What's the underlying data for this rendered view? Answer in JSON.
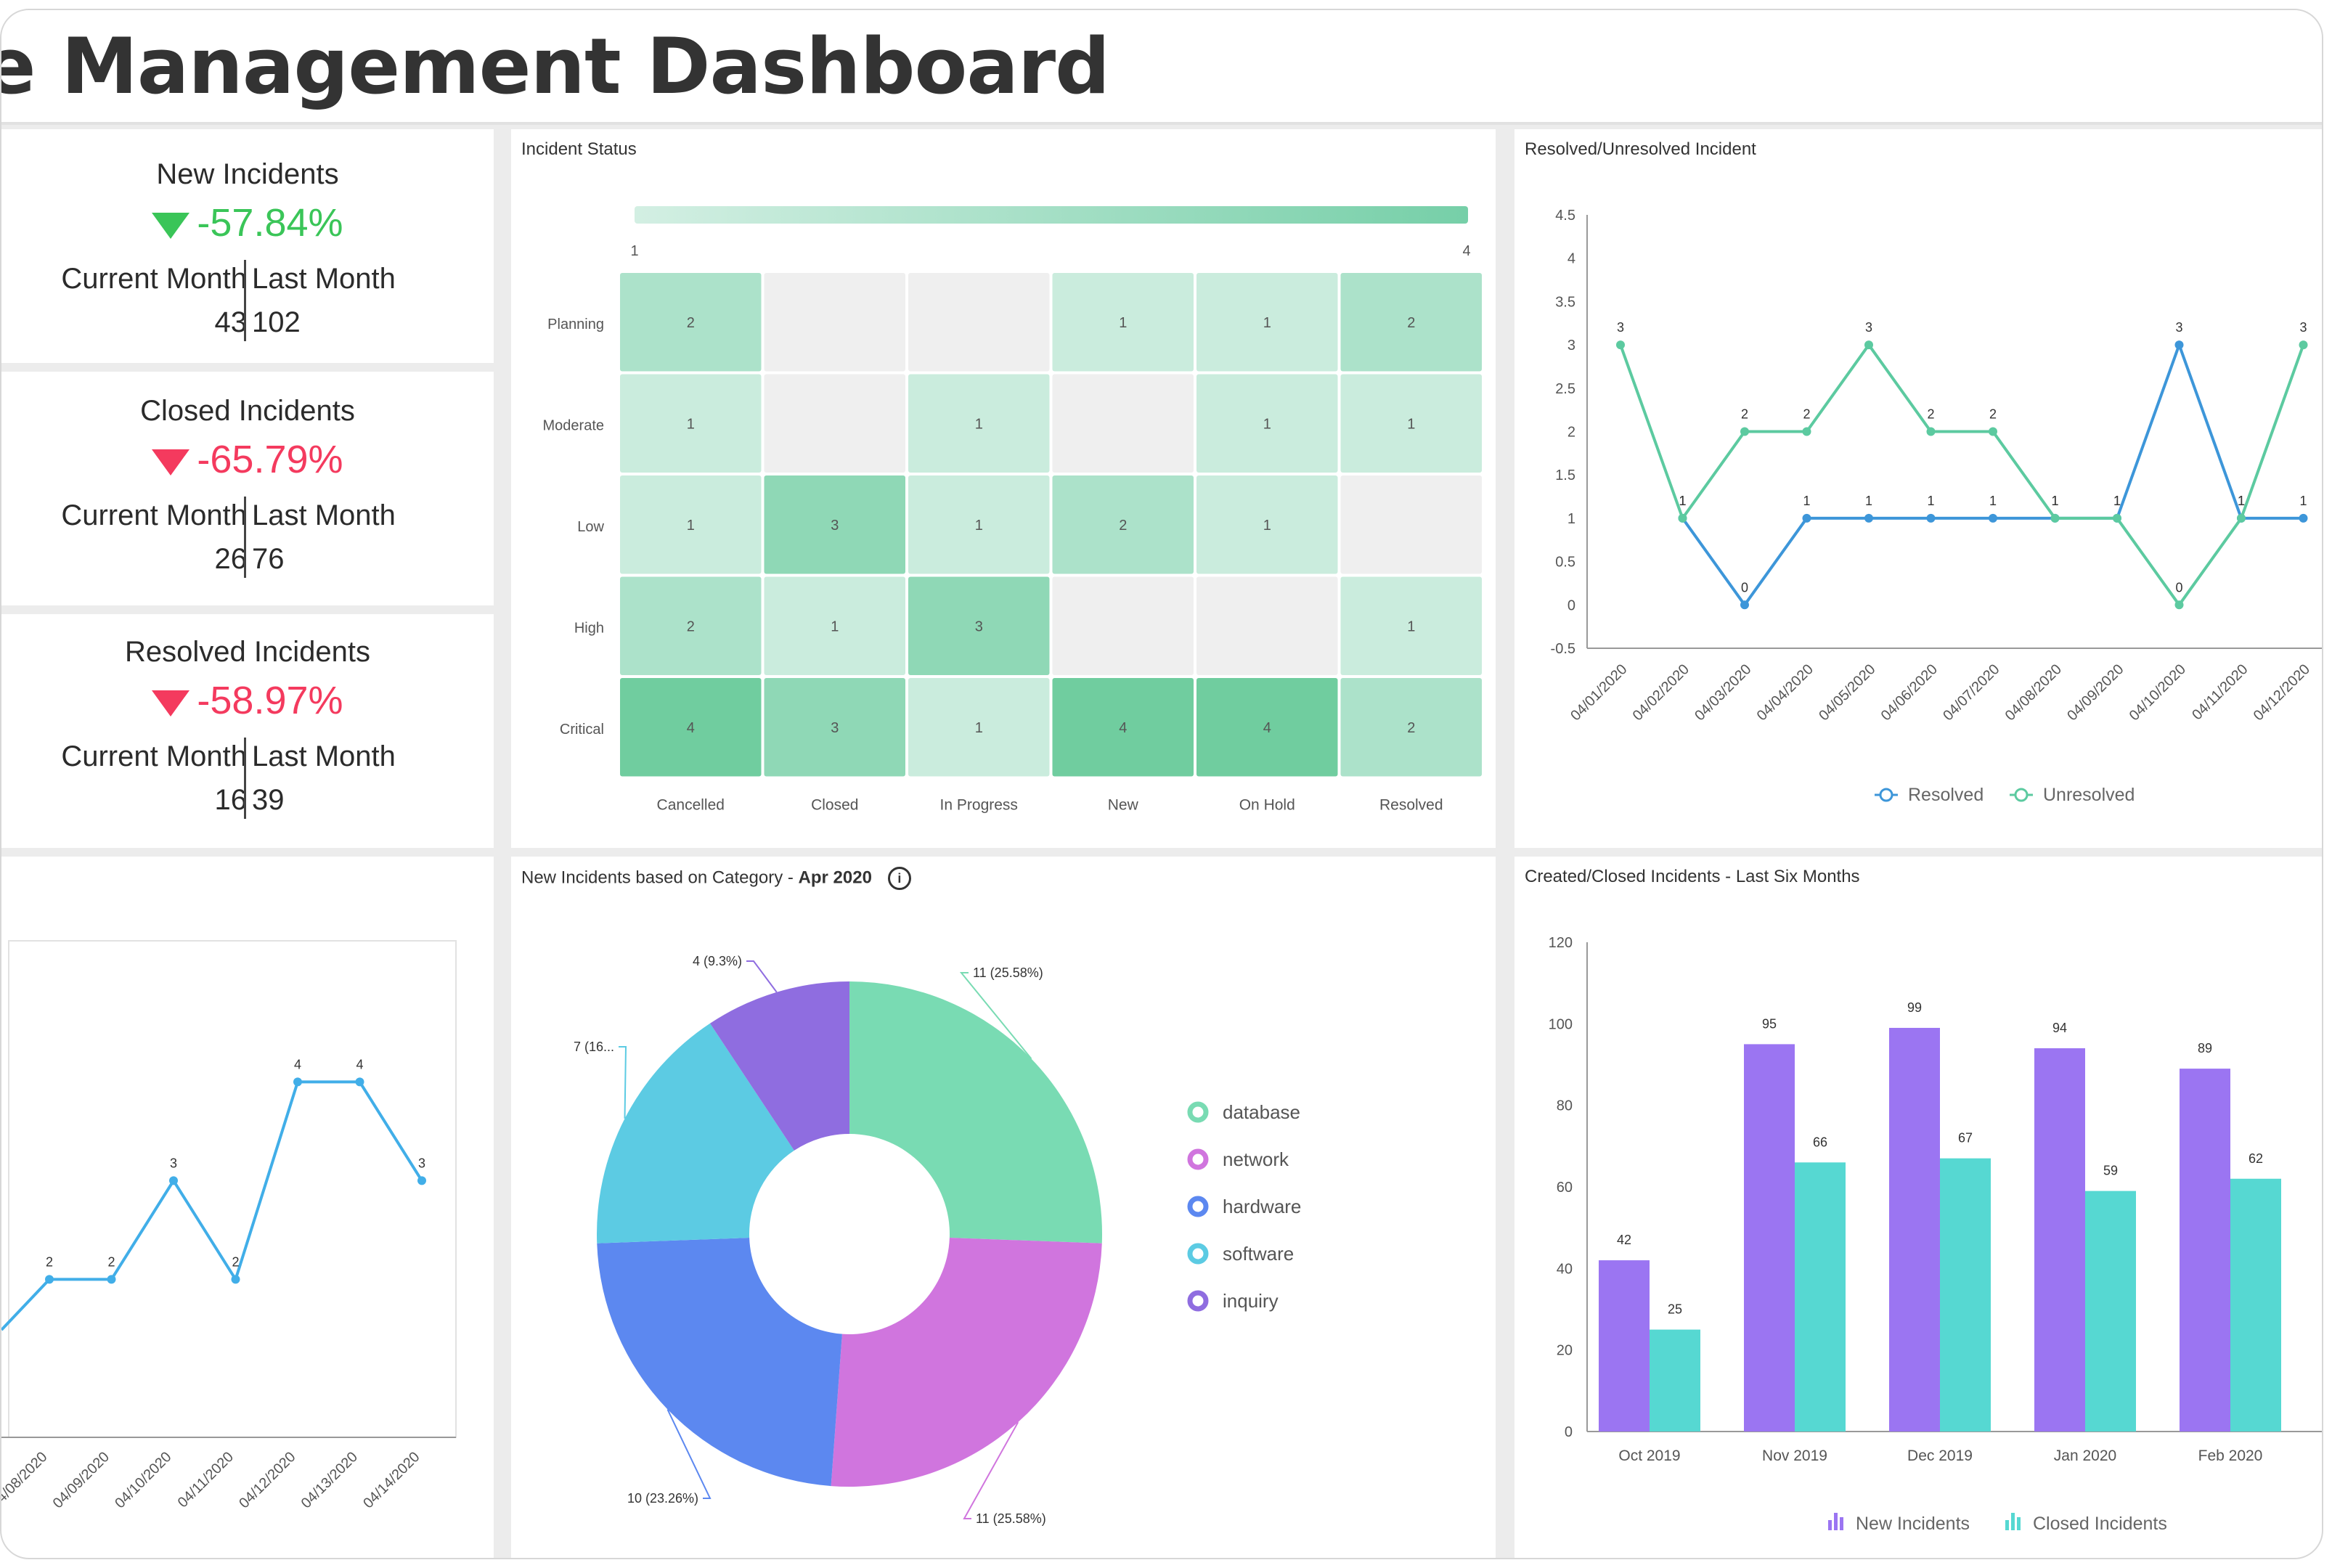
{
  "header": {
    "title": "onse Management Dashboard"
  },
  "kpis": [
    {
      "title": "New Incidents",
      "change": "-57.84%",
      "direction": "down",
      "color": "#3ac558",
      "current_label": "Current Month",
      "last_label": "Last Month",
      "current": "43",
      "last": "102"
    },
    {
      "title": "Closed Incidents",
      "change": "-65.79%",
      "direction": "down",
      "color": "#f43a5e",
      "current_label": "Current Month",
      "last_label": "Last Month",
      "current": "26",
      "last": "76"
    },
    {
      "title": "Resolved Incidents",
      "change": "-58.97%",
      "direction": "down",
      "color": "#f43a5e",
      "current_label": "Current Month",
      "last_label": "Last Month",
      "current": "16",
      "last": "39"
    }
  ],
  "heatmap": {
    "title": "Incident Status",
    "scale_min": "1",
    "scale_max": "4"
  },
  "resolved_chart": {
    "title": "Resolved/Unresolved Incident"
  },
  "category_chart": {
    "title_prefix": "New Incidents based on Category - ",
    "title_bold": "Apr 2020"
  },
  "created_closed_chart": {
    "title": "Created/Closed Incidents - Last Six Months"
  },
  "colors": {
    "resolved": "#3d96d9",
    "unresolved": "#5ccaa0",
    "trend": "#41aee8",
    "new_incidents": "#9b75f2",
    "closed_incidents": "#56d8d2",
    "database": "#79dbb3",
    "network": "#d075de",
    "hardware": "#5c88f0",
    "software": "#5ccbe3",
    "inquiry": "#8f6de0"
  },
  "chart_data": [
    {
      "type": "heatmap",
      "title": "Incident Status",
      "rows": [
        "Planning",
        "Moderate",
        "Low",
        "High",
        "Critical"
      ],
      "columns": [
        "Cancelled",
        "Closed",
        "In Progress",
        "New",
        "On Hold",
        "Resolved"
      ],
      "values": [
        [
          2,
          null,
          null,
          1,
          1,
          2
        ],
        [
          1,
          null,
          1,
          null,
          1,
          1
        ],
        [
          1,
          3,
          1,
          2,
          1,
          null
        ],
        [
          2,
          1,
          3,
          null,
          null,
          1
        ],
        [
          4,
          3,
          1,
          4,
          4,
          2
        ]
      ],
      "scale": [
        1,
        4
      ]
    },
    {
      "type": "line",
      "title": "Resolved/Unresolved Incident",
      "x": [
        "04/01/2020",
        "04/02/2020",
        "04/03/2020",
        "04/04/2020",
        "04/05/2020",
        "04/06/2020",
        "04/07/2020",
        "04/08/2020",
        "04/09/2020",
        "04/10/2020",
        "04/11/2020",
        "04/12/2020"
      ],
      "series": [
        {
          "name": "Resolved",
          "values": [
            null,
            1,
            0,
            1,
            1,
            1,
            1,
            1,
            1,
            3,
            1,
            1
          ]
        },
        {
          "name": "Unresolved",
          "values": [
            3,
            1,
            2,
            2,
            3,
            2,
            2,
            1,
            1,
            0,
            1,
            3
          ]
        }
      ],
      "y_ticks": [
        "4.5",
        "4",
        "3.5",
        "3",
        "2.5",
        "2",
        "1.5",
        "1",
        "0.5",
        "0",
        "-0.5"
      ],
      "ylim": [
        -0.5,
        4.5
      ],
      "legend": "bottom"
    },
    {
      "type": "line",
      "x": [
        "04/08/2020",
        "04/09/2020",
        "04/10/2020",
        "04/11/2020",
        "04/12/2020",
        "04/13/2020",
        "04/14/2020"
      ],
      "series": [
        {
          "values": [
            2,
            2,
            3,
            2,
            4,
            4,
            3
          ]
        }
      ]
    },
    {
      "type": "pie",
      "title": "New Incidents based on Category - Apr 2020",
      "slices": [
        {
          "name": "database",
          "value": 11,
          "label": "11 (25.58%)"
        },
        {
          "name": "network",
          "value": 11,
          "label": "11 (25.58%)"
        },
        {
          "name": "hardware",
          "value": 10,
          "label": "10 (23.26%)"
        },
        {
          "name": "software",
          "value": 7,
          "label": "7 (16..."
        },
        {
          "name": "inquiry",
          "value": 4,
          "label": "4 (9.3%)"
        }
      ],
      "legend": "right"
    },
    {
      "type": "bar",
      "title": "Created/Closed Incidents - Last Six Months",
      "categories": [
        "Oct 2019",
        "Nov 2019",
        "Dec 2019",
        "Jan 2020",
        "Feb 2020"
      ],
      "series": [
        {
          "name": "New Incidents",
          "values": [
            42,
            95,
            99,
            94,
            89
          ]
        },
        {
          "name": "Closed Incidents",
          "values": [
            25,
            66,
            67,
            59,
            62
          ]
        }
      ],
      "y_ticks": [
        "120",
        "100",
        "80",
        "60",
        "40",
        "20",
        "0"
      ],
      "ylim": [
        0,
        120
      ],
      "legend": "bottom"
    }
  ]
}
